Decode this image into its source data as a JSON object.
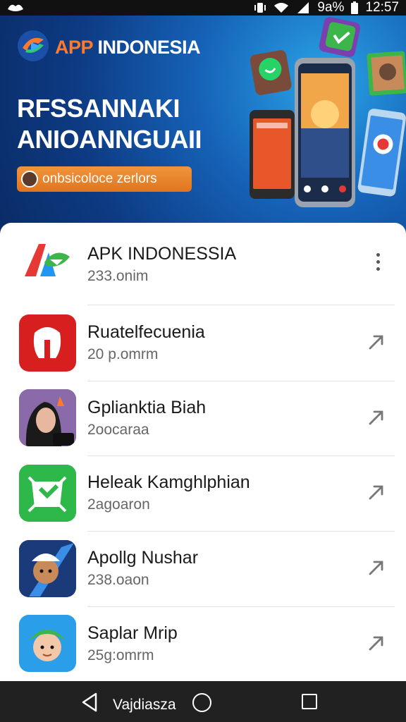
{
  "status_bar": {
    "battery": "9a%",
    "time": "12:57"
  },
  "banner": {
    "brand_prefix": "APP",
    "brand_name": "INDONESIA",
    "headline_line1": "RFSSANNAKI",
    "headline_line2": "ANIOANNGUAII",
    "promo_text": "onbsicoloce zerlors"
  },
  "apps": [
    {
      "name": "APK INDONESSIA",
      "meta": "233.onim",
      "action": "more-icon"
    },
    {
      "name": "Ruatelfecuenia",
      "meta": "20 p.omrm",
      "action": "arrow-icon"
    },
    {
      "name": "Gplianktia Biah",
      "meta": "2oocaraa",
      "action": "arrow-icon"
    },
    {
      "name": "Heleak Kamghlphian",
      "meta": "2agoaron",
      "action": "arrow-icon"
    },
    {
      "name": "Apollg Nushar",
      "meta": "238.oaon",
      "action": "arrow-icon"
    },
    {
      "name": "Saplar Mrip",
      "meta": "25g:omrm",
      "action": "arrow-icon"
    }
  ],
  "nav_bar": {
    "label": "Vajdiasza"
  },
  "colors": {
    "brand_orange": "#ff7a2a",
    "banner_blue": "#0d3a82",
    "nav_dark": "#212121"
  }
}
